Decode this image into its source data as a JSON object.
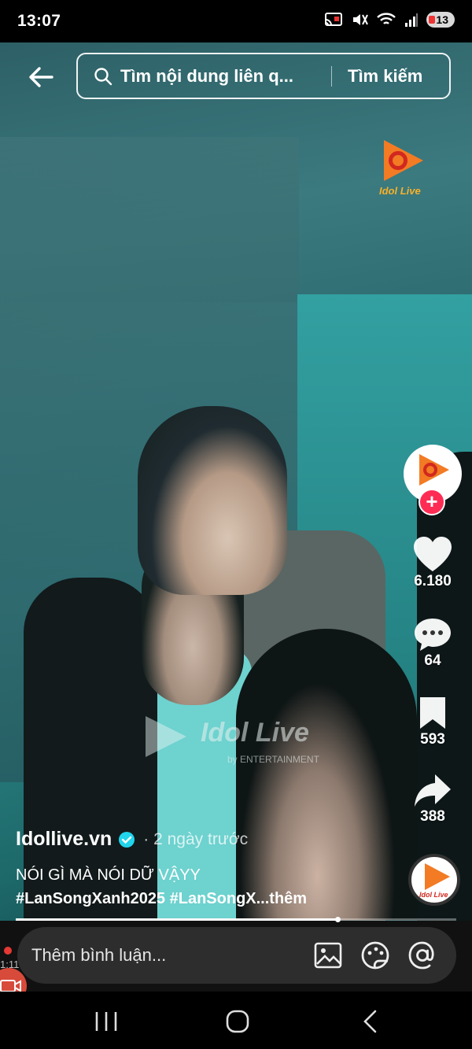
{
  "status_bar": {
    "time": "13:07",
    "battery": "13"
  },
  "search": {
    "placeholder": "Tìm nội dung liên q...",
    "button_label": "Tìm kiếm"
  },
  "brand": {
    "logo_text": "Idol Live",
    "watermark_title": "Idol Live",
    "watermark_sub": "by ENTERTAINMENT"
  },
  "rail": {
    "likes": "6.180",
    "comments": "64",
    "saves": "593",
    "shares": "388",
    "follow_symbol": "+"
  },
  "post": {
    "author": "Idollive.vn",
    "time": "· 2 ngày trước",
    "caption": "NÓI GÌ MÀ NÓI DỮ VẬYY",
    "hashtags": "#LanSongXanh2025 #LanSongX...thêm",
    "progress": 0.73
  },
  "comment": {
    "placeholder": "Thêm bình luận..."
  },
  "recorder": {
    "time": "1:11"
  },
  "colors": {
    "accent": "#fe2c55",
    "brand_orange": "#f27b24",
    "brand_red": "#d1281f",
    "video_teal": "#2f8a8a"
  }
}
